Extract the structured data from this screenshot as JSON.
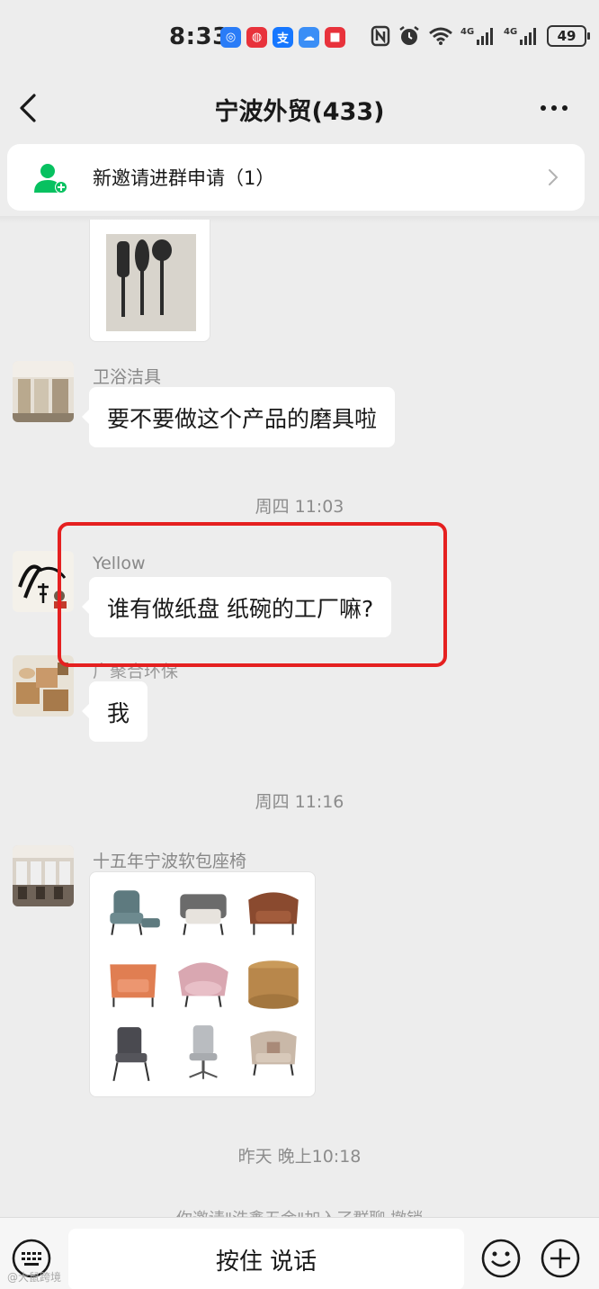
{
  "status_bar": {
    "time": "8:33",
    "battery": "49",
    "app_icons": [
      {
        "name": "app-blue-icon",
        "glyph": "◎",
        "color": "#2a7cf7"
      },
      {
        "name": "app-red-icon",
        "glyph": "◍",
        "color": "#e8323b"
      },
      {
        "name": "alipay-icon",
        "glyph": "支",
        "color": "#1677ff"
      },
      {
        "name": "cloud-icon",
        "glyph": "☁",
        "color": "#3a8ef6"
      },
      {
        "name": "app-red-square-icon",
        "glyph": "■",
        "color": "#e8323b"
      }
    ],
    "network": [
      "4G",
      "4G"
    ]
  },
  "nav": {
    "title": "宁波外贸(433)"
  },
  "invite": {
    "text": "新邀请进群申请（1）"
  },
  "messages": {
    "m1": {
      "sender": "卫浴洁具",
      "text": "要不要做这个产品的磨具啦"
    },
    "t1": "周四 11:03",
    "m2": {
      "sender": "Yellow",
      "text": "谁有做纸盘  纸碗的工厂嘛?"
    },
    "m3": {
      "sender": "广聚合环保",
      "text": "我"
    },
    "t2": "周四 11:16",
    "m4": {
      "sender": "十五年宁波软包座椅"
    },
    "t3": "昨天 晚上10:18",
    "system": "你邀请\"浩鑫五金\"加入了群聊  撤销"
  },
  "input": {
    "talk_label": "按住 说话"
  },
  "watermark": "@大鼠跨境",
  "colors": {
    "background": "#ededed",
    "highlight": "#e52020",
    "accent_green": "#07c160"
  }
}
